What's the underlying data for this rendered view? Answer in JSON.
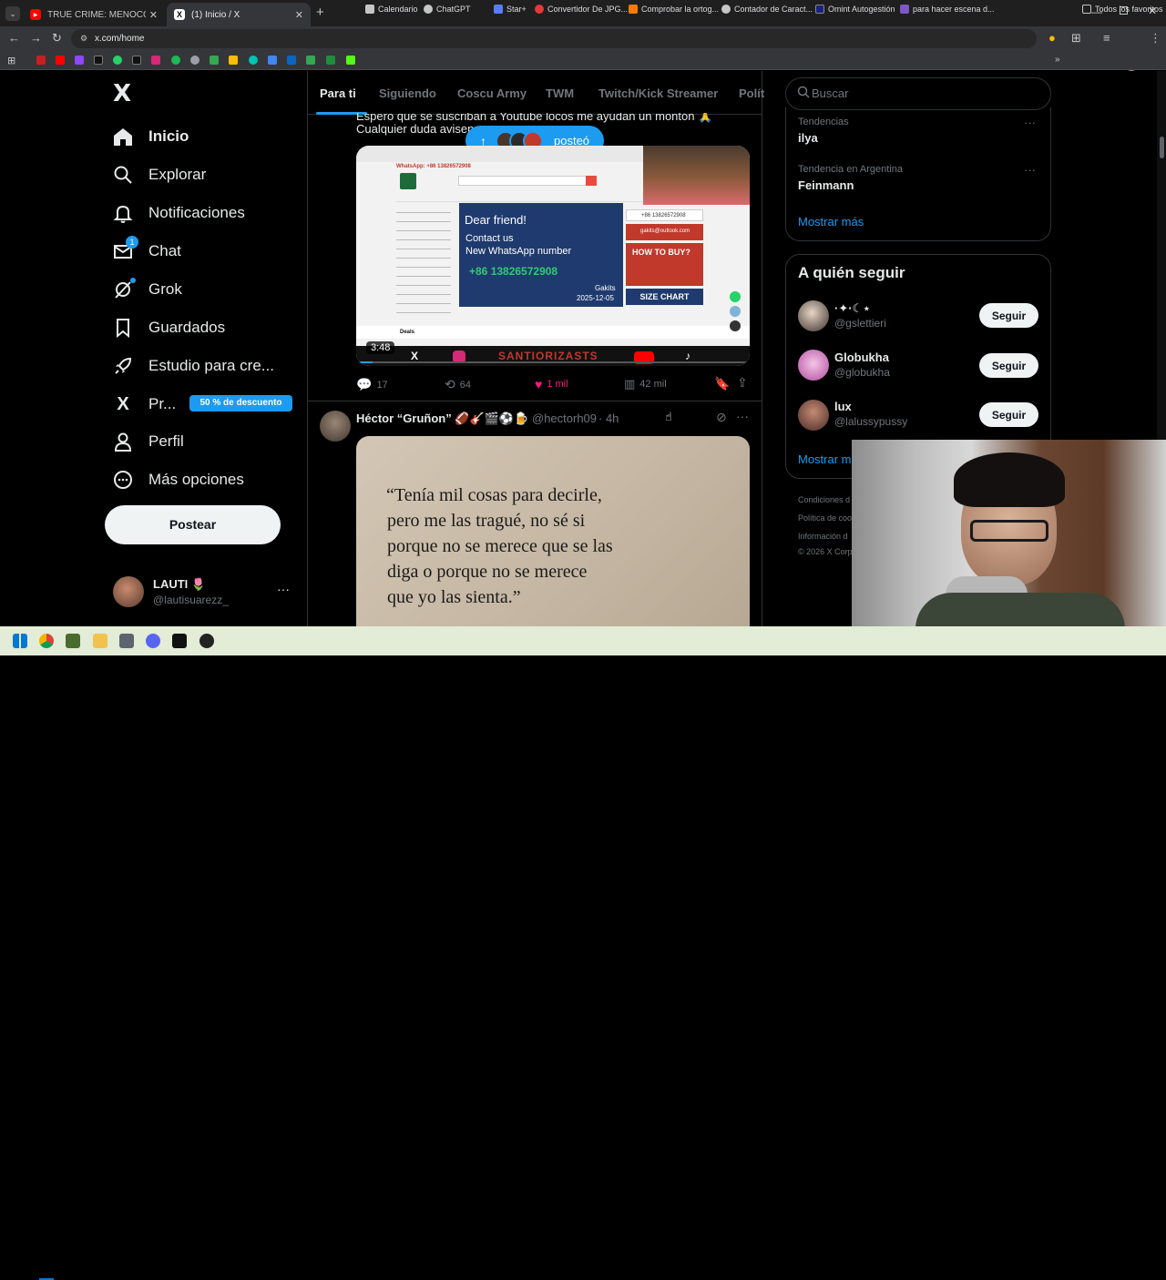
{
  "browser": {
    "tabs": [
      {
        "title": "TRUE CRIME: MENOCCHIO, EL ...",
        "close": "✕"
      },
      {
        "title": "(1) Inicio / X",
        "close": "✕"
      }
    ],
    "new_tab": "+",
    "url": "x.com/home",
    "bookmarks": [
      {
        "label": "Calendario"
      },
      {
        "label": "ChatGPT"
      },
      {
        "label": "Star+"
      },
      {
        "label": "Convertidor De JPG..."
      },
      {
        "label": "Comprobar la ortog..."
      },
      {
        "label": "Contador de Caract..."
      },
      {
        "label": "Omint Autogestión"
      },
      {
        "label": "para hacer escena d..."
      }
    ],
    "all_bookmarks": "Todos los favoritos"
  },
  "sidebar": {
    "logo": "X",
    "items": [
      {
        "label": "Inicio",
        "icon": "home-icon"
      },
      {
        "label": "Explorar",
        "icon": "search-icon"
      },
      {
        "label": "Notificaciones",
        "icon": "bell-icon"
      },
      {
        "label": "Chat",
        "icon": "mail-icon",
        "badge": "1"
      },
      {
        "label": "Grok",
        "icon": "grok-icon"
      },
      {
        "label": "Guardados",
        "icon": "bookmark-icon"
      },
      {
        "label": "Estudio para cre...",
        "icon": "rocket-icon"
      },
      {
        "label": "Pr...",
        "icon": "x-icon",
        "promo": "50 % de descuento"
      },
      {
        "label": "Perfil",
        "icon": "user-icon"
      },
      {
        "label": "Más opciones",
        "icon": "more-circle-icon"
      }
    ],
    "post_button": "Postear",
    "account": {
      "name": "LAUTI 🌷",
      "handle": "@lautisuarezz_",
      "more": "···"
    }
  },
  "feed": {
    "tabs": [
      "Para ti",
      "Siguiendo",
      "Coscu Army",
      "TWM",
      "Twitch/Kick Streamer",
      "Polít"
    ],
    "post1": {
      "text_line1": "Espero que se suscriban a Youtube locos me ayudan un montón 🙏",
      "text_line2": "Cualquier duda avisen",
      "posted_pill": "posteó",
      "video_time": "3:48",
      "video": {
        "whatsapp": "WhatsApp: +86 13826572908",
        "dear": "Dear friend!",
        "contact": "Contact us",
        "new_number": "New WhatsApp number",
        "number": "+86 13826572908",
        "signature": "Gakits",
        "date": "2025-12-05",
        "phone_small": "+86 13826572908",
        "email": "gakits@outlook.com",
        "how": "HOW TO BUY?",
        "size": "SIZE CHART",
        "deals": "Deals",
        "channel": "SANTIORIZASTS"
      },
      "stats": {
        "replies": "17",
        "reposts": "64",
        "likes": "1 mil",
        "views": "42 mil"
      }
    },
    "post2": {
      "name": "Héctor “Gruñon” 🏈🎸🎬⚽🍺",
      "handle": "@hectorh09",
      "time": "· 4h",
      "quote_line1": "“Tenía mil cosas para decirle,",
      "quote_line2": "pero me las tragué, no sé si",
      "quote_line3": "porque no se merece que se las",
      "quote_line4": "diga o porque no se merece",
      "quote_line5": "que yo las sienta.”"
    }
  },
  "right": {
    "search_placeholder": "Buscar",
    "trends": [
      {
        "context": "Tendencias",
        "topic": "ilya"
      },
      {
        "context": "Tendencia en Argentina",
        "topic": "Feinmann"
      }
    ],
    "show_more": "Mostrar más",
    "who_to_follow": "A quién seguir",
    "suggestions": [
      {
        "name": "·✦·☾⋆",
        "handle": "@gslettieri",
        "button": "Seguir"
      },
      {
        "name": "Globukha",
        "handle": "@globukha",
        "button": "Seguir"
      },
      {
        "name": "lux",
        "handle": "@lalussypussy",
        "button": "Seguir"
      }
    ],
    "show_more2": "Mostrar m",
    "footer": [
      "Condiciones d",
      "Política de coo",
      "Información d",
      "© 2026 X Corp"
    ]
  },
  "colors": {
    "accent": "#1d9bf0",
    "like": "#f91880",
    "bg": "#000000",
    "muted": "#71767b"
  }
}
